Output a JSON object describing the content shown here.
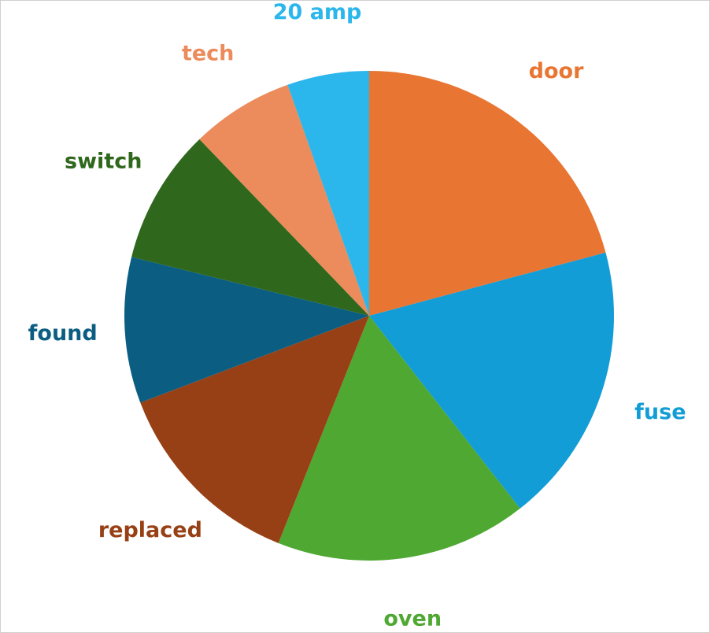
{
  "chart_data": {
    "type": "pie",
    "title": "",
    "start": "12 o'clock",
    "direction": "clockwise",
    "slices": [
      {
        "label": "door",
        "value": 21.2,
        "color": "#e87532"
      },
      {
        "label": "fuse",
        "value": 18.9,
        "color": "#139dd6"
      },
      {
        "label": "oven",
        "value": 16.9,
        "color": "#4ea832"
      },
      {
        "label": "replaced",
        "value": 13.4,
        "color": "#984015"
      },
      {
        "label": "found",
        "value": 9.8,
        "color": "#0b5e82"
      },
      {
        "label": "switch",
        "value": 9.1,
        "color": "#2f681c"
      },
      {
        "label": "tech",
        "value": 6.9,
        "color": "#ec8b5b"
      },
      {
        "label": "20 amp",
        "value": 5.5,
        "color": "#2bb6ec"
      }
    ],
    "label_colors": [
      "#e87532",
      "#139dd6",
      "#4ea832",
      "#984015",
      "#0b5e82",
      "#2f681c",
      "#ec8b5b",
      "#2bb6ec"
    ]
  }
}
